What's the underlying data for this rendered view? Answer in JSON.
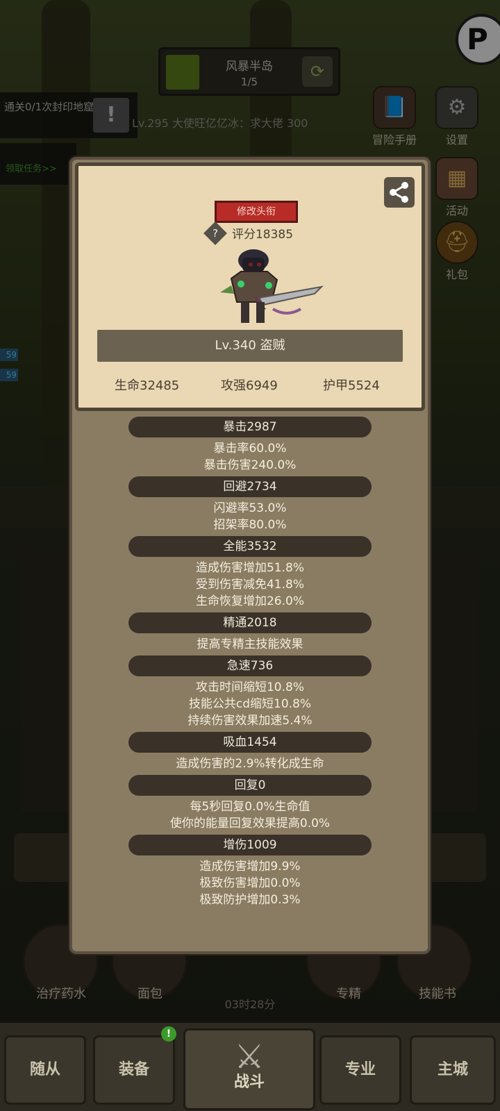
{
  "stage": {
    "name": "风暴半岛",
    "progress": "1/5",
    "refresh_icon": "refresh-icon"
  },
  "quest": {
    "text": "通关0/1次封印地窟",
    "task_link": "领取任务>>"
  },
  "chat": {
    "line": "Lv.295 大使旺亿亿冰：求大佬 300"
  },
  "side_buttons": [
    {
      "label": "冒险手册",
      "icon": "book-icon"
    },
    {
      "label": "设置",
      "icon": "gear-icon"
    },
    {
      "label": "活动",
      "icon": "calendar-icon"
    },
    {
      "label": "礼包",
      "icon": "gift-icon"
    }
  ],
  "left_tags": [
    "59",
    "59"
  ],
  "bottom_items": [
    "治疗药水",
    "面包",
    "专精",
    "技能书"
  ],
  "timer": "03时28分",
  "tabs": [
    "随从",
    "装备",
    "战斗",
    "专业",
    "主城"
  ],
  "tab_badge": "!",
  "profile": {
    "title_button": "修改头衔",
    "score_label": "评分18385",
    "level_class": "Lv.340 盗贼",
    "stats": [
      "生命32485",
      "攻强6949",
      "护甲5524"
    ]
  },
  "stat_groups": [
    {
      "header": "暴击2987",
      "lines": [
        "暴击率60.0%",
        "暴击伤害240.0%"
      ]
    },
    {
      "header": "回避2734",
      "lines": [
        "闪避率53.0%",
        "招架率80.0%"
      ]
    },
    {
      "header": "全能3532",
      "lines": [
        "造成伤害增加51.8%",
        "受到伤害减免41.8%",
        "生命恢复增加26.0%"
      ]
    },
    {
      "header": "精通2018",
      "lines": [
        "提高专精主技能效果"
      ]
    },
    {
      "header": "急速736",
      "lines": [
        "攻击时间缩短10.8%",
        "技能公共cd缩短10.8%",
        "持续伤害效果加速5.4%"
      ]
    },
    {
      "header": "吸血1454",
      "lines": [
        "造成伤害的2.9%转化成生命"
      ]
    },
    {
      "header": "回复0",
      "lines": [
        "每5秒回复0.0%生命值",
        "使你的能量回复效果提高0.0%"
      ]
    },
    {
      "header": "增伤1009",
      "lines": [
        "造成伤害增加9.9%",
        "极致伤害增加0.0%",
        "极致防护增加0.3%"
      ]
    }
  ]
}
